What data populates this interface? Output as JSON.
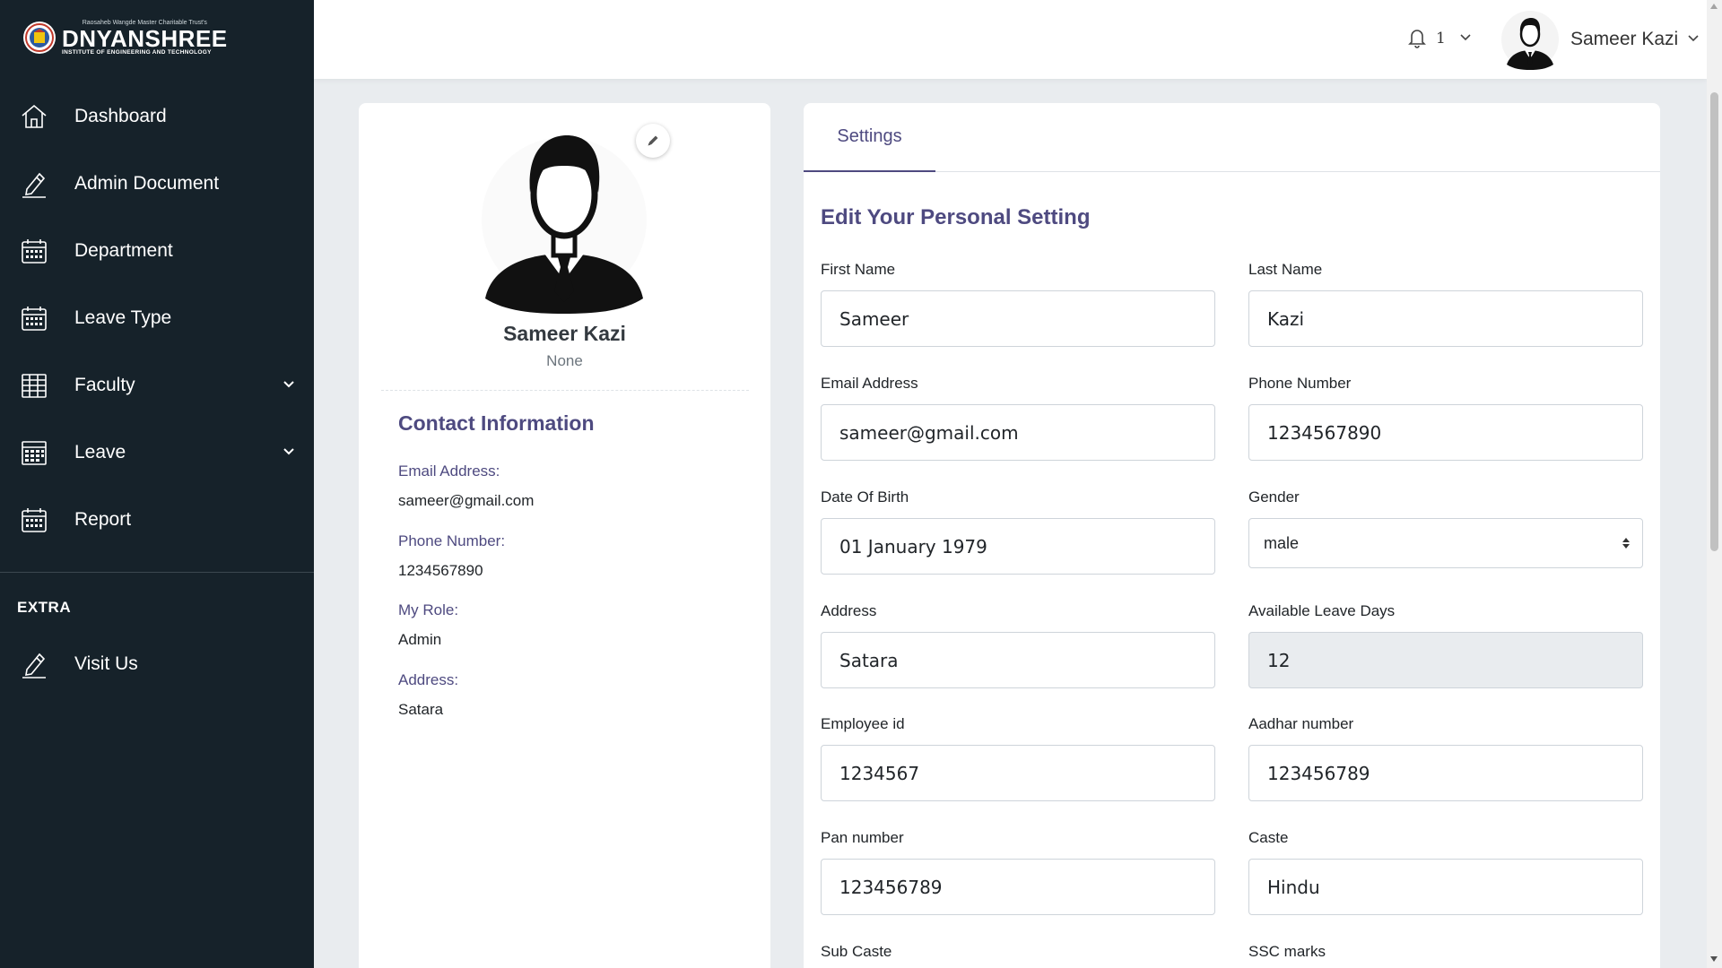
{
  "sidebar": {
    "logo": {
      "top_line": "Raosaheb Wangde Master Charitable Trust's",
      "name": "DNYANSHREE",
      "subtitle": "INSTITUTE OF ENGINEERING AND TECHNOLOGY"
    },
    "items": [
      {
        "label": "Dashboard",
        "icon": "home-icon"
      },
      {
        "label": "Admin Document",
        "icon": "pencil-icon"
      },
      {
        "label": "Department",
        "icon": "calendar-icon"
      },
      {
        "label": "Leave Type",
        "icon": "calendar-icon"
      },
      {
        "label": "Faculty",
        "icon": "table-icon",
        "has_dropdown": true
      },
      {
        "label": "Leave",
        "icon": "calendar-grid-icon",
        "has_dropdown": true
      },
      {
        "label": "Report",
        "icon": "calendar-icon"
      }
    ],
    "extra_title": "EXTRA",
    "extra_items": [
      {
        "label": "Visit Us",
        "icon": "pencil-icon"
      }
    ]
  },
  "header": {
    "notification_count": "1",
    "user_name": "Sameer Kazi"
  },
  "profile": {
    "name": "Sameer Kazi",
    "role_text": "None",
    "contact_title": "Contact Information",
    "contacts": [
      {
        "label": "Email Address:",
        "value": "sameer@gmail.com"
      },
      {
        "label": "Phone Number:",
        "value": "1234567890"
      },
      {
        "label": "My Role:",
        "value": "Admin"
      },
      {
        "label": "Address:",
        "value": "Satara"
      }
    ]
  },
  "settings": {
    "tab_label": "Settings",
    "form_title": "Edit Your Personal Setting",
    "fields": {
      "first_name": {
        "label": "First Name",
        "value": "Sameer"
      },
      "last_name": {
        "label": "Last Name",
        "value": "Kazi"
      },
      "email": {
        "label": "Email Address",
        "value": "sameer@gmail.com"
      },
      "phone": {
        "label": "Phone Number",
        "value": "1234567890"
      },
      "dob": {
        "label": "Date Of Birth",
        "value": "01 January 1979"
      },
      "gender": {
        "label": "Gender",
        "value": "male"
      },
      "address": {
        "label": "Address",
        "value": "Satara"
      },
      "leave_days": {
        "label": "Available Leave Days",
        "value": "12"
      },
      "employee_id": {
        "label": "Employee id",
        "value": "1234567"
      },
      "aadhar": {
        "label": "Aadhar number",
        "value": "123456789"
      },
      "pan": {
        "label": "Pan number",
        "value": "123456789"
      },
      "caste": {
        "label": "Caste",
        "value": "Hindu"
      },
      "sub_caste": {
        "label": "Sub Caste"
      },
      "ssc_marks": {
        "label": "SSC marks"
      }
    }
  },
  "colors": {
    "sidebar_bg": "#16222a",
    "accent": "#4e4a80",
    "page_bg": "#e9ecef"
  }
}
